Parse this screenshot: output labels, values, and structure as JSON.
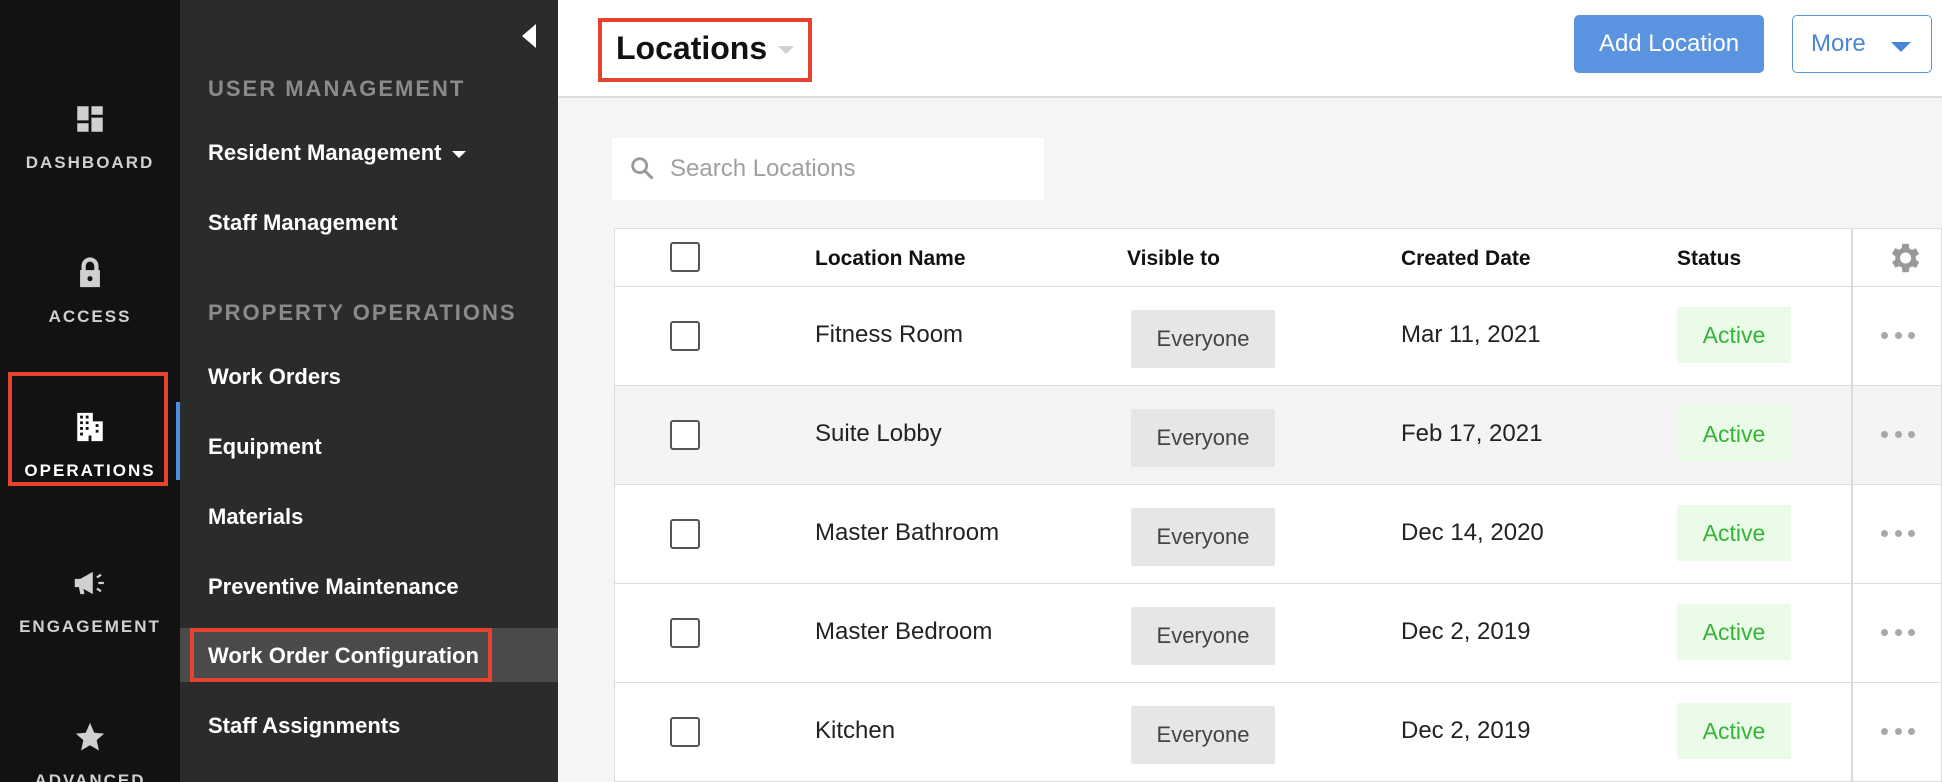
{
  "rail": {
    "items": [
      {
        "label": "DASHBOARD",
        "icon": "dashboard-icon"
      },
      {
        "label": "ACCESS",
        "icon": "lock-icon"
      },
      {
        "label": "OPERATIONS",
        "icon": "building-icon"
      },
      {
        "label": "ENGAGEMENT",
        "icon": "megaphone-icon"
      },
      {
        "label": "ADVANCED",
        "icon": "star-icon"
      }
    ],
    "active": "OPERATIONS"
  },
  "subnav": {
    "sections": [
      {
        "heading": "USER MANAGEMENT",
        "items": [
          {
            "label": "Resident Management"
          },
          {
            "label": "Staff Management"
          }
        ]
      },
      {
        "heading": "PROPERTY OPERATIONS",
        "items": [
          {
            "label": "Work Orders"
          },
          {
            "label": "Equipment"
          },
          {
            "label": "Materials"
          },
          {
            "label": "Preventive Maintenance"
          },
          {
            "label": "Work Order Configuration"
          },
          {
            "label": "Staff Assignments"
          }
        ]
      }
    ],
    "active": "Work Order Configuration"
  },
  "header": {
    "title": "Locations",
    "add_button": "Add Location",
    "more_button": "More"
  },
  "search": {
    "placeholder": "Search Locations"
  },
  "table": {
    "columns": [
      "Location Name",
      "Visible to",
      "Created Date",
      "Status"
    ],
    "rows": [
      {
        "name": "Fitness Room",
        "visible": "Everyone",
        "date": "Mar 11, 2021",
        "status": "Active"
      },
      {
        "name": "Suite Lobby",
        "visible": "Everyone",
        "date": "Feb 17, 2021",
        "status": "Active"
      },
      {
        "name": "Master Bathroom",
        "visible": "Everyone",
        "date": "Dec 14, 2020",
        "status": "Active"
      },
      {
        "name": "Master Bedroom",
        "visible": "Everyone",
        "date": "Dec 2, 2019",
        "status": "Active"
      },
      {
        "name": "Kitchen",
        "visible": "Everyone",
        "date": "Dec 2, 2019",
        "status": "Active"
      }
    ]
  },
  "colors": {
    "accent": "#5a94e0",
    "highlight": "#e5432d",
    "status_active": "#35b43a",
    "rail_bg": "#121212",
    "subnav_bg": "#2b2b2b"
  }
}
